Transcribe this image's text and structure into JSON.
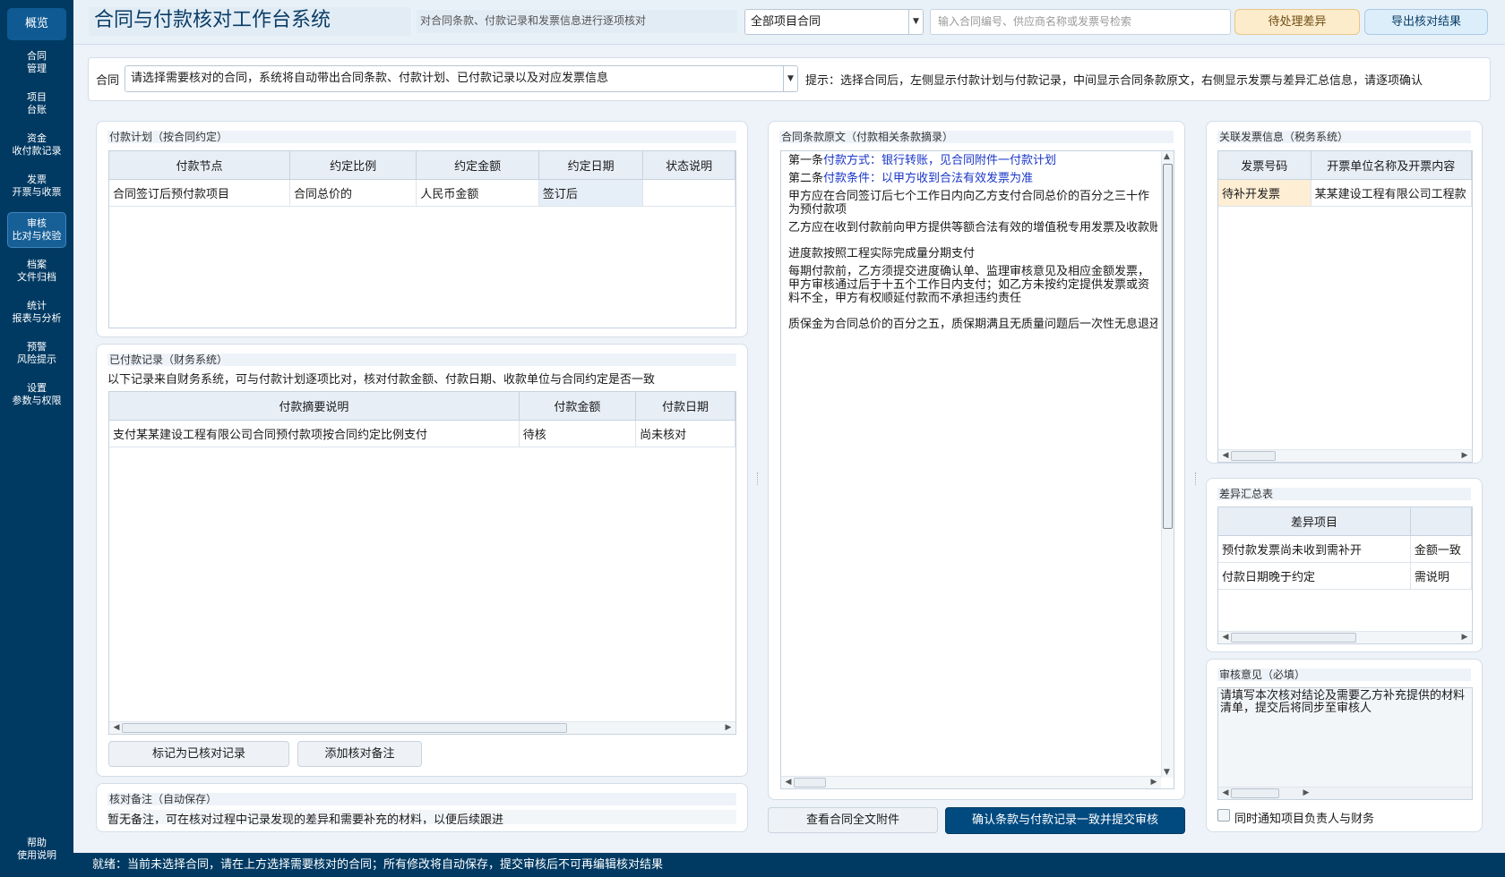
{
  "sidebar": {
    "home_label": "概览",
    "items": [
      {
        "line1": "合同",
        "line2": "管理"
      },
      {
        "line1": "项目",
        "line2": "台账"
      },
      {
        "line1": "资金",
        "line2": "收付款记录"
      },
      {
        "line1": "发票",
        "line2": "开票与收票"
      },
      {
        "line1": "审核",
        "line2": "比对与校验"
      },
      {
        "line1": "档案",
        "line2": "文件归档"
      },
      {
        "line1": "统计",
        "line2": "报表与分析"
      },
      {
        "line1": "预警",
        "line2": "风险提示"
      },
      {
        "line1": "设置",
        "line2": "参数与权限"
      }
    ],
    "footer": {
      "line1": "帮助",
      "line2": "使用说明"
    }
  },
  "header": {
    "title": "合同与付款核对工作台系统",
    "subtitle": "对合同条款、付款记录和发票信息进行逐项核对",
    "project_select": "全部项目合同",
    "search_placeholder": "输入合同编号、供应商名称或发票号检索",
    "warn_button": "待处理差异",
    "info_button": "导出核对结果"
  },
  "context": {
    "label": "合同",
    "selected": "请选择需要核对的合同，系统将自动带出合同条款、付款计划、已付款记录以及对应发票信息",
    "hint": "提示：选择合同后，左侧显示付款计划与付款记录，中间显示合同条款原文，右侧显示发票与差异汇总信息，请逐项确认"
  },
  "plan_panel": {
    "title": "付款计划（按合同约定）",
    "columns": [
      "付款节点",
      "约定比例",
      "约定金额",
      "约定日期",
      "状态说明"
    ],
    "rows": [
      [
        "合同签订后预付款项目",
        "合同总价的",
        "人民币金额",
        "签订后",
        ""
      ]
    ]
  },
  "records_panel": {
    "title": "已付款记录（财务系统）",
    "description": "以下记录来自财务系统，可与付款计划逐项比对，核对付款金额、付款日期、收款单位与合同约定是否一致",
    "columns": [
      "付款摘要说明",
      "付款金额",
      "付款日期"
    ],
    "rows": [
      [
        "支付某某建设工程有限公司合同预付款项按合同约定比例支付",
        "待核",
        "尚未核对"
      ]
    ],
    "buttons": [
      "标记为已核对记录",
      "添加核对备注"
    ]
  },
  "notes_panel": {
    "title": "核对备注（自动保存）",
    "text": "暂无备注，可在核对过程中记录发现的差异和需要补充的材料，以便后续跟进"
  },
  "clause_panel": {
    "title": "合同条款原文（付款相关条款摘录）",
    "lines": [
      {
        "prefix": "第一条",
        "link": "付款方式：银行转账，见合同附件一付款计划"
      },
      {
        "prefix": "第二条",
        "link": "付款条件：以甲方收到合法有效发票为准"
      },
      {
        "text": "甲方应在合同签订后七个工作日内向乙方支付合同总价的百分之三十作为预付款项",
        "wrap": true
      },
      {
        "text": "乙方应在收到付款前向甲方提供等额合法有效的增值税专用发票及收款账户确认书"
      },
      {
        "text": "进度款按照工程实际完成量分期支付"
      },
      {
        "text": "每期付款前，乙方须提交进度确认单、监理审核意见及相应金额发票，甲方审核通过后于十五个工作日内支付；如乙方未按约定提供发票或资料不全，甲方有权顺延付款而不承担违约责任",
        "wrap": true
      },
      {
        "text": "质保金为合同总价的百分之五，质保期满且无质量问题后一次性无息退还"
      }
    ],
    "bottom_buttons": {
      "secondary": "查看合同全文附件",
      "primary": "确认条款与付款记录一致并提交审核"
    }
  },
  "invoice_panel": {
    "title": "关联发票信息（税务系统）",
    "columns": [
      "发票号码",
      "开票单位名称及开票内容"
    ],
    "rows": [
      [
        "待补开发票",
        "某某建设工程有限公司工程款"
      ]
    ]
  },
  "diff_panel": {
    "title": "差异汇总表",
    "columns": [
      "差异项目",
      ""
    ],
    "rows": [
      [
        "预付款发票尚未收到需补开",
        "金额一致"
      ],
      [
        "付款日期晚于约定",
        "需说明"
      ]
    ]
  },
  "comment_panel": {
    "title": "审核意见（必填）",
    "text": "请填写本次核对结论及需要乙方补充提供的材料清单，提交后将同步至审核人",
    "checkbox_label": "同时通知项目负责人与财务"
  },
  "statusbar": {
    "text": "就绪：当前未选择合同，请在上方选择需要核对的合同；所有修改将自动保存，提交审核后不可再编辑核对结果"
  }
}
